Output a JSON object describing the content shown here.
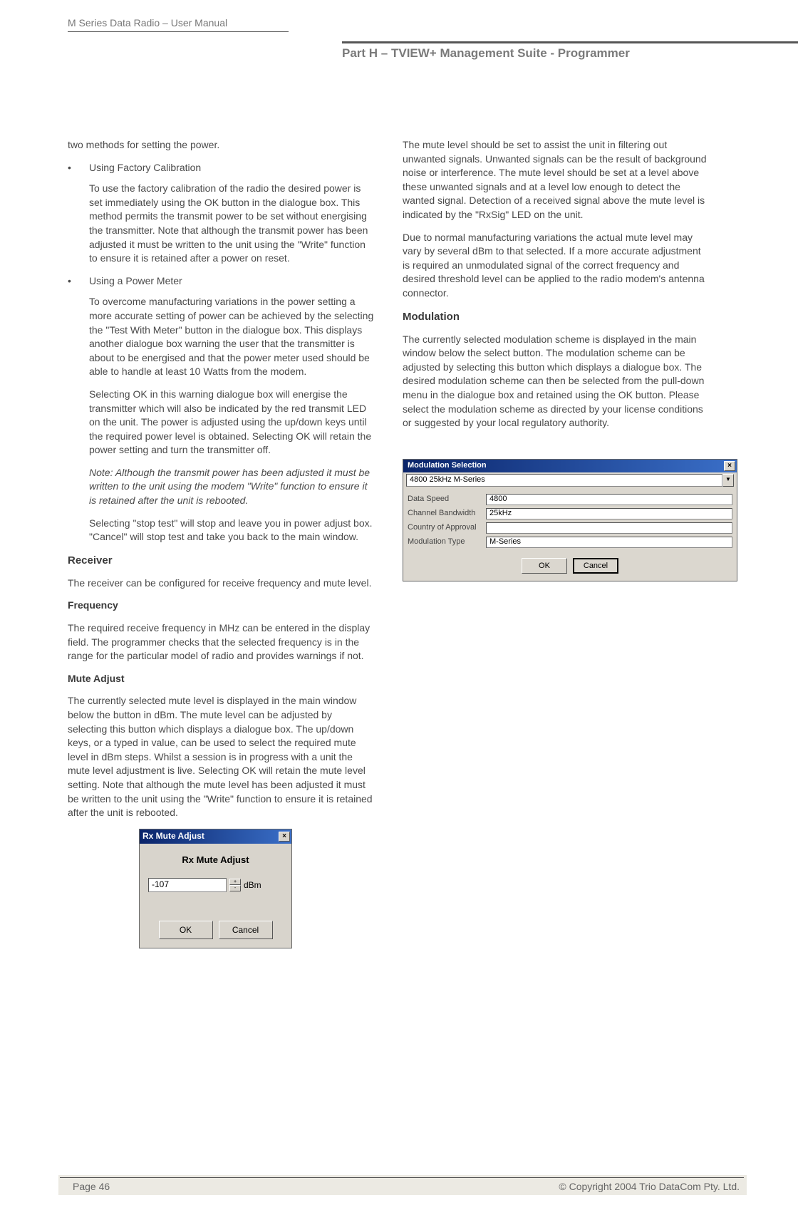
{
  "header": {
    "left": "M Series Data Radio – User Manual",
    "right": "Part H – TVIEW+ Management Suite - Programmer"
  },
  "left_col": {
    "intro": "two methods for setting the power.",
    "b1": "Using Factory Calibration",
    "b1_p1": "To use the factory calibration of the radio the desired power is set immediately using the OK button in the dialogue box. This method permits the transmit power to be set without energising the transmitter. Note that although the transmit power has been adjusted it must be written to the unit using the \"Write\" function to ensure it is retained after a power on reset.",
    "b2": "Using a Power Meter",
    "b2_p1": "To overcome manufacturing variations in the power setting a more accurate setting of power can be achieved by the selecting the \"Test With Meter\" button in the dialogue box. This displays another dialogue box warning the user that the transmitter is about to be energised and that the power meter used should be able to handle at least 10 Watts from the modem.",
    "b2_p2": "Selecting OK in this warning dialogue box will energise the transmitter which will also be indicated by the red transmit LED on the unit. The power is adjusted using the up/down keys until the required power level is obtained. Selecting OK will retain the power setting and turn the transmitter off.",
    "b2_note": "Note: Although the transmit power has been adjusted it must be written to the unit using the modem \"Write\" function to ensure it is retained after the unit is rebooted.",
    "b2_p3": "Selecting \"stop test\" will stop and leave you in power adjust box. \"Cancel\" will stop test and take you back to the main window.",
    "receiver_h": "Receiver",
    "receiver_p": "The receiver can be configured for receive frequency and mute level.",
    "freq_h": "Frequency",
    "freq_p": "The required receive frequency in MHz can be entered in the display field.  The programmer checks that the selected frequency is in the range for the particular model of radio and provides warnings if not.",
    "mute_h": "Mute Adjust",
    "mute_p": "The currently selected mute level is displayed in the main window below the button in dBm. The mute level can be adjusted by selecting this button which displays a dialogue box. The up/down keys, or a typed in value, can be used to select the required mute level in dBm steps. Whilst a session is in progress with a unit the mute level adjustment is live. Selecting OK will retain the mute level setting. Note that although the mute level has been adjusted it must be written to the unit using the \"Write\" function to ensure it is retained after the unit is rebooted."
  },
  "rx_dialog": {
    "title": "Rx Mute Adjust",
    "body_title": "Rx Mute Adjust",
    "value": "-107",
    "unit": "dBm",
    "ok": "OK",
    "cancel": "Cancel"
  },
  "right_col": {
    "p1": "The mute level should be set to assist the unit in filtering out unwanted signals. Unwanted signals can be the result of background noise or interference. The mute level should be set at a level above these unwanted signals and at a level low enough to detect the wanted signal. Detection of a received signal above the mute level is indicated by the \"RxSig\" LED on the unit.",
    "p2": "Due to normal manufacturing variations the actual mute level may vary by several dBm to that selected. If a more accurate adjustment is required an unmodulated signal of the correct frequency and desired threshold level can be applied to the radio modem's antenna connector.",
    "mod_h": "Modulation",
    "mod_p": "The currently selected modulation scheme is displayed in the main window below the select button. The modulation scheme can be adjusted by selecting this button which displays a dialogue box. The desired modulation scheme can then be selected from the pull-down menu in the dialogue box and retained using the OK button. Please select the modulation scheme as directed by your license conditions or suggested by your local regulatory authority."
  },
  "mod_dialog": {
    "title": "Modulation Selection",
    "dropdown": "4800 25kHz  M-Series",
    "rows": {
      "data_speed_label": "Data Speed",
      "data_speed_value": "4800",
      "channel_bw_label": "Channel Bandwidth",
      "channel_bw_value": "25kHz",
      "country_label": "Country of Approval",
      "country_value": "",
      "mod_type_label": "Modulation Type",
      "mod_type_value": "M-Series"
    },
    "ok": "OK",
    "cancel": "Cancel"
  },
  "footer": {
    "page": "Page 46",
    "copyright": "© Copyright 2004 Trio DataCom Pty. Ltd."
  }
}
